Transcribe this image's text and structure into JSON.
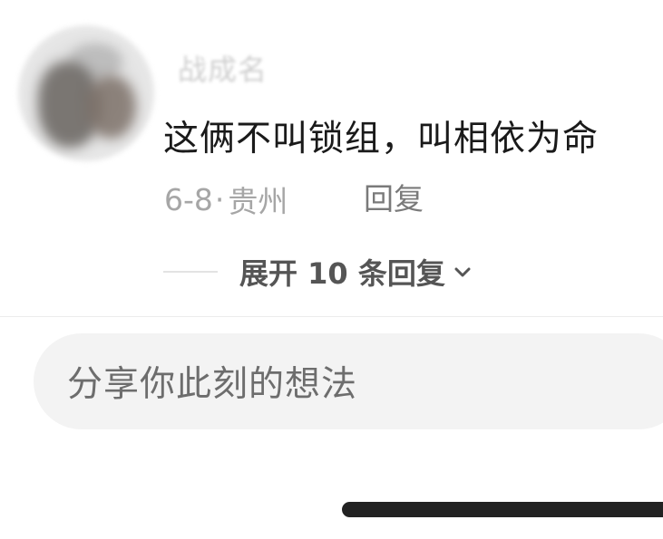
{
  "comment": {
    "username": "战成名",
    "text": "这俩不叫锁组，叫相依为命",
    "date": "6-8",
    "separator": "·",
    "location": "贵州",
    "reply_label": "回复"
  },
  "replies": {
    "expand_label": "展开 10 条回复"
  },
  "composer": {
    "placeholder": "分享你此刻的想法"
  },
  "icons": {
    "expand": "chevron-down-icon"
  }
}
